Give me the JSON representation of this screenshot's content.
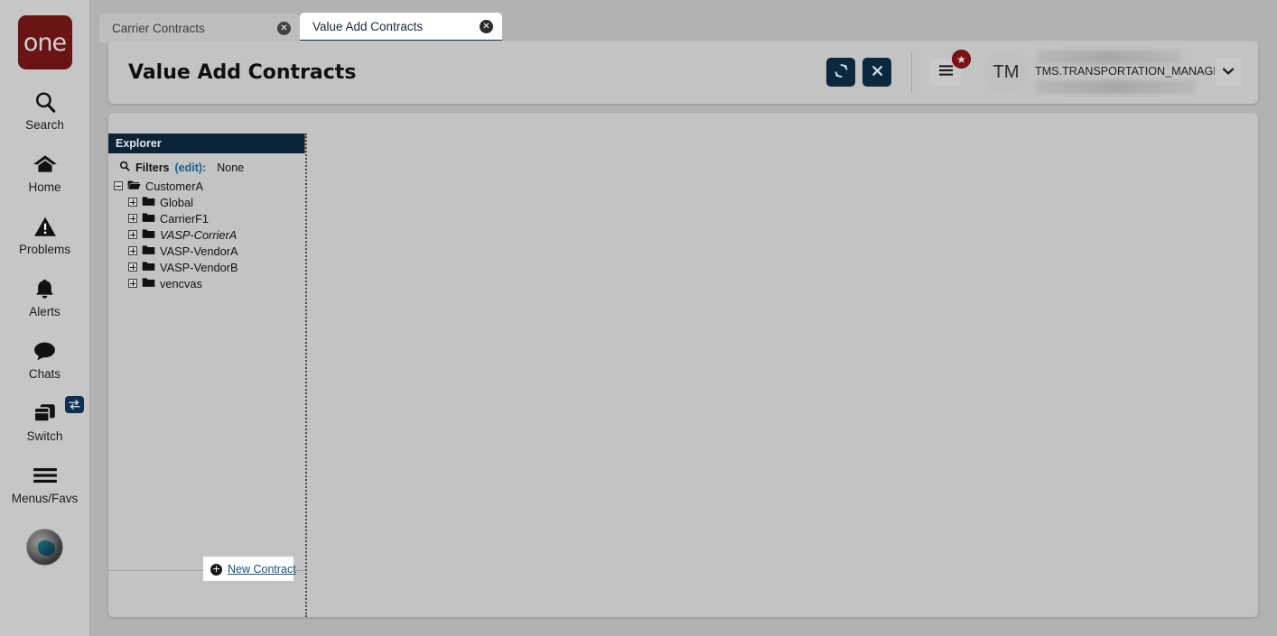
{
  "app": {
    "logo_text": "one",
    "rail_items": [
      {
        "icon": "search-icon",
        "label": "Search"
      },
      {
        "icon": "home-icon",
        "label": "Home"
      },
      {
        "icon": "warning-triangle-icon",
        "label": "Problems"
      },
      {
        "icon": "bell-icon",
        "label": "Alerts"
      },
      {
        "icon": "chat-bubble-icon",
        "label": "Chats"
      },
      {
        "icon": "switch-windows-icon",
        "label": "Switch"
      },
      {
        "icon": "hamburger-icon",
        "label": "Menus/Favs"
      }
    ]
  },
  "tabs": [
    {
      "label": "Carrier Contracts",
      "active": false,
      "close": "✕"
    },
    {
      "label": "Value Add Contracts",
      "active": true,
      "close": "✕"
    }
  ],
  "header": {
    "title": "Value Add Contracts",
    "refresh_icon": "refresh-icon",
    "close_icon": "close-icon",
    "menu_icon": "hamburger-icon",
    "badge_icon": "★",
    "avatar_initials": "TM",
    "user_name": "TMS.TRANSPORTATION_MANAGER",
    "caret_icon": "chevron-down-icon"
  },
  "explorer": {
    "title": "Explorer",
    "filters": {
      "search_icon": "search-icon",
      "label": "Filters",
      "edit_link": "(edit):",
      "value": "None"
    },
    "tree": [
      {
        "label": "CustomerA",
        "level": 0,
        "expanded": true,
        "italic": false
      },
      {
        "label": "Global",
        "level": 1,
        "expanded": false,
        "italic": false
      },
      {
        "label": "CarrierF1",
        "level": 1,
        "expanded": false,
        "italic": false
      },
      {
        "label": "VASP-CorrierA",
        "level": 1,
        "expanded": false,
        "italic": true
      },
      {
        "label": "VASP-VendorA",
        "level": 1,
        "expanded": false,
        "italic": false
      },
      {
        "label": "VASP-VendorB",
        "level": 1,
        "expanded": false,
        "italic": false
      },
      {
        "label": "vencvas",
        "level": 1,
        "expanded": false,
        "italic": false
      }
    ],
    "new_contract": {
      "plus": "+",
      "label": "New Contract"
    }
  },
  "colors": {
    "page_bg": "#b2b2b2",
    "card_bg": "#c3c3c3",
    "rail_bg": "#c6c6c6",
    "navy": "#0c2438",
    "logo_maroon": "#6b1416",
    "link_blue": "#14527a",
    "badge_red": "#7d1113"
  }
}
